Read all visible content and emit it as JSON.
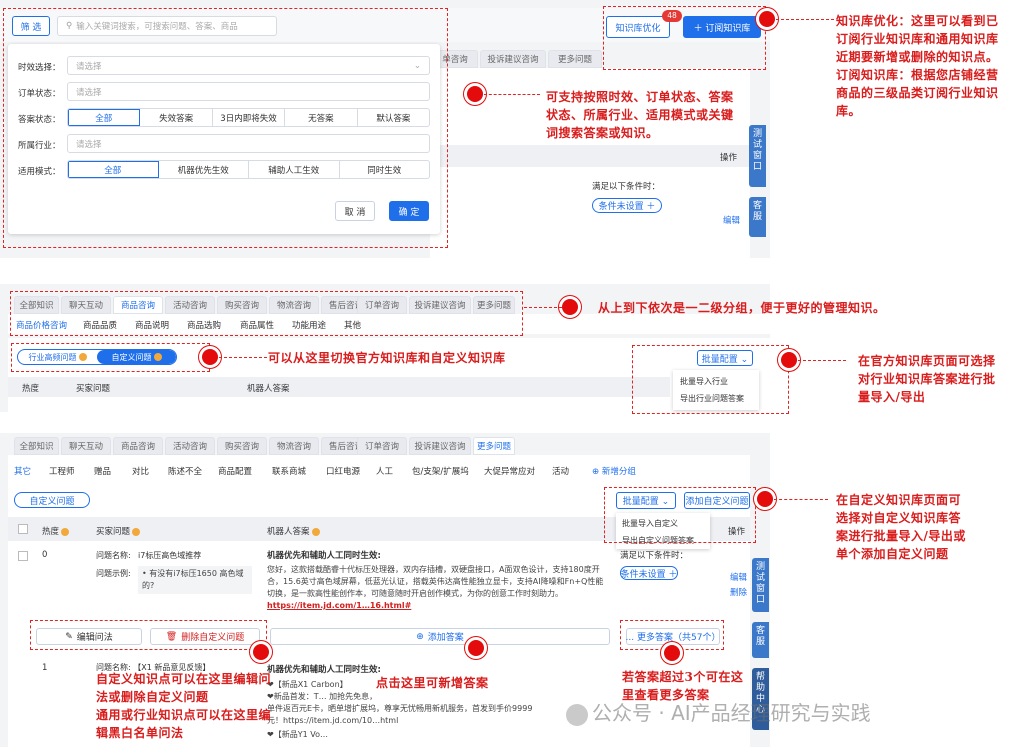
{
  "p1": {
    "filter_btn": "筛 选",
    "search_placeholder": "输入关键词搜索，可搜索问题、答案、商品",
    "optimize_btn": "知识库优化",
    "optimize_badge": "48",
    "subscribe_btn": "＋ 订阅知识库",
    "tabs": [
      "单咨询",
      "投诉建议咨询",
      "更多问题"
    ],
    "op_header": "操作",
    "cond_label": "满足以下条件时：",
    "cond_btn": "条件未设置 ＋",
    "edit": "编辑",
    "form": {
      "label_time": "时效选择：",
      "ph_time": "请选择",
      "label_order": "订单状态：",
      "ph_order": "请选择",
      "label_answer": "答案状态：",
      "answer_opts": [
        "全部",
        "失效答案",
        "3日内即将失效",
        "无答案",
        "默认答案"
      ],
      "label_industry": "所属行业：",
      "ph_industry": "请选择",
      "label_mode": "适用模式：",
      "mode_opts": [
        "全部",
        "机器优先生效",
        "辅助人工生效",
        "同时生效"
      ],
      "cancel": "取 消",
      "ok": "确 定"
    },
    "side_test": "测试窗口",
    "side_service": "客服"
  },
  "p2": {
    "tabs": [
      "全部知识",
      "聊天互动",
      "商品咨询",
      "活动咨询",
      "购买咨询",
      "物流咨询",
      "售后咨询",
      "订单咨询",
      "投诉建议咨询",
      "更多问题"
    ],
    "subtabs": [
      "商品价格咨询",
      "商品品质",
      "商品说明",
      "商品选购",
      "商品属性",
      "功能用途",
      "其他"
    ],
    "toggle_official": "行业高频问题",
    "toggle_custom": "自定义问题",
    "batch_btn": "批量配置 ⌄",
    "menu": [
      "批量导入行业",
      "导出行业问题答案"
    ],
    "col_hot": "热度",
    "col_q": "买家问题",
    "col_a": "机器人答案"
  },
  "p3": {
    "tabs": [
      "全部知识",
      "聊天互动",
      "商品咨询",
      "活动咨询",
      "购买咨询",
      "物流咨询",
      "售后咨询",
      "订单咨询",
      "投诉建议咨询",
      "更多问题"
    ],
    "subtabs": [
      "其它",
      "工程师",
      "赠品",
      "对比",
      "陈述不全",
      "商品配置",
      "联系商城",
      "口红电源",
      "人工",
      "包/支架/扩展坞",
      "大促异常应对",
      "活动"
    ],
    "new_group": "新增分组",
    "custom_btn": "自定义问题",
    "batch_btn": "批量配置 ⌄",
    "add_btn": "添加自定义问题",
    "menu": [
      "批量导入自定义",
      "导出自定义问题答案"
    ],
    "col_hot": "热度",
    "col_q": "买家问题",
    "col_a": "机器人答案",
    "col_op": "操作",
    "row1": {
      "idx": "0",
      "q_name_label": "问题名称:",
      "q_name": "i7标压高色域推荐",
      "q_example_label": "问题示例:",
      "q_example": "• 有没有i7标压1650 高色域的?",
      "a_title": "机器优先和辅助人工同时生效:",
      "a_body": "您好，这款搭载酷睿十代标压处理器，双内存插槽，双硬盘接口，A面双色设计，支持180度开合，15.6英寸高色域屏幕，低蓝光认证，搭载英伟达高性能独立显卡，支持AI降噪和Fn+Q性能切换，是一款高性能创作本，可随意随时开启创作模式，为你的创意工作时刻助力。",
      "a_link": "https://item.jd.com/1…16.html#",
      "cond_label": "满足以下条件时：",
      "cond_btn": "条件未设置 ＋",
      "edit": "编辑",
      "delete": "删除"
    },
    "actions": {
      "edit_q": "编辑问法",
      "del_q": "删除自定义问题",
      "add_answer": "添加答案",
      "more_answer": "... 更多答案（共57个）"
    },
    "row2": {
      "idx": "1",
      "q_name": "问题名称: 【X1 新品意见反馈】",
      "a_title": "机器优先和辅助人工同时生效:",
      "a_line1": "❤【新品X1 Carbon】",
      "a_line2": "❤新品首发：T… 加抢先免息，",
      "a_line3": "单件返百元E卡，晒单增扩展坞，尊享无忧畅用新机服务，首发到手价9999",
      "a_line4": "元！https://item.jd.com/10…html",
      "a_line5": "❤【新品Y1 Vo…"
    },
    "side_test": "测试窗口",
    "side_service": "客服",
    "side_help": "帮助中心"
  },
  "notes": {
    "n1": "知识库优化：这里可以看到已订阅行业知识库和通用知识库近期要新增或删除的知识点。\n订阅知识库：根据您店铺经营商品的三级品类订阅行业知识库。",
    "n2": "可支持按照时效、订单状态、答案状态、所属行业、适用模式或关键词搜索答案或知识。",
    "n3": "从上到下依次是一二级分组，便于更好的管理知识。",
    "n4": "可以从这里切换官方知识库和自定义知识库",
    "n5": "在官方知识库页面可选择对行业知识库答案进行批量导入/导出",
    "n6": "在自定义知识库页面可选择对自定义知识库答案进行批量导入/导出或单个添加自定义问题",
    "n7": "自定义知识点可以在这里编辑问法或删除自定义问题\n通用或行业知识点可以在这里编辑黑白名单问法",
    "n8": "点击这里可新增答案",
    "n9": "若答案超过3个可在这里查看更多答案"
  },
  "watermark": "公众号 · AI产品经理研究与实践"
}
